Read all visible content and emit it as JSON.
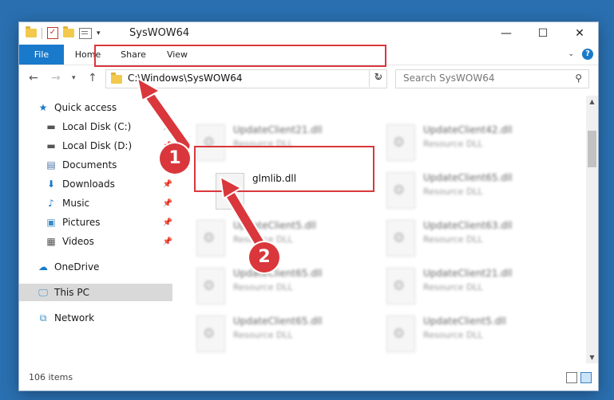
{
  "window": {
    "title": "SysWOW64"
  },
  "ribbon": {
    "tabs": [
      "File",
      "Home",
      "Share",
      "View"
    ]
  },
  "address": {
    "path": "C:\\Windows\\SysWOW64",
    "search_placeholder": "Search SysWOW64"
  },
  "sidebar": {
    "items": [
      {
        "label": "Quick access",
        "icon": "star-icon",
        "pinned": false
      },
      {
        "label": "Local Disk (C:)",
        "icon": "drive-icon",
        "pinned": true
      },
      {
        "label": "Local Disk (D:)",
        "icon": "drive-icon",
        "pinned": true
      },
      {
        "label": "Documents",
        "icon": "document-icon",
        "pinned": true
      },
      {
        "label": "Downloads",
        "icon": "download-icon",
        "pinned": true
      },
      {
        "label": "Music",
        "icon": "music-icon",
        "pinned": true
      },
      {
        "label": "Pictures",
        "icon": "pictures-icon",
        "pinned": true
      },
      {
        "label": "Videos",
        "icon": "video-icon",
        "pinned": true
      },
      {
        "label": "OneDrive",
        "icon": "cloud-icon",
        "pinned": false
      },
      {
        "label": "This PC",
        "icon": "computer-icon",
        "pinned": false,
        "selected": true
      },
      {
        "label": "Network",
        "icon": "network-icon",
        "pinned": false
      }
    ]
  },
  "files": {
    "highlighted": {
      "name": "glmlib.dll"
    },
    "blurred": [
      {
        "name": "UpdateClient21.dll",
        "type": "Resource DLL"
      },
      {
        "name": "UpdateClient42.dll",
        "type": "Resource DLL"
      },
      {
        "name": "UpdateClient65.dll",
        "type": "Resource DLL"
      },
      {
        "name": "UpdateClient5.dll",
        "type": "Resource DLL"
      },
      {
        "name": "UpdateClient63.dll",
        "type": "Resource DLL"
      },
      {
        "name": "UpdateClient65.dll",
        "type": "Resource DLL"
      },
      {
        "name": "UpdateClient21.dll",
        "type": "Resource DLL"
      },
      {
        "name": "UpdateClient65.dll",
        "type": "Resource DLL"
      },
      {
        "name": "UpdateClient5.dll",
        "type": "Resource DLL"
      }
    ]
  },
  "status": {
    "item_count": "106 items"
  },
  "annotations": {
    "step1": "1",
    "step2": "2",
    "color": "#d9373c"
  },
  "colors": {
    "accent": "#1979ca",
    "desktop": "#2a6fb0"
  }
}
